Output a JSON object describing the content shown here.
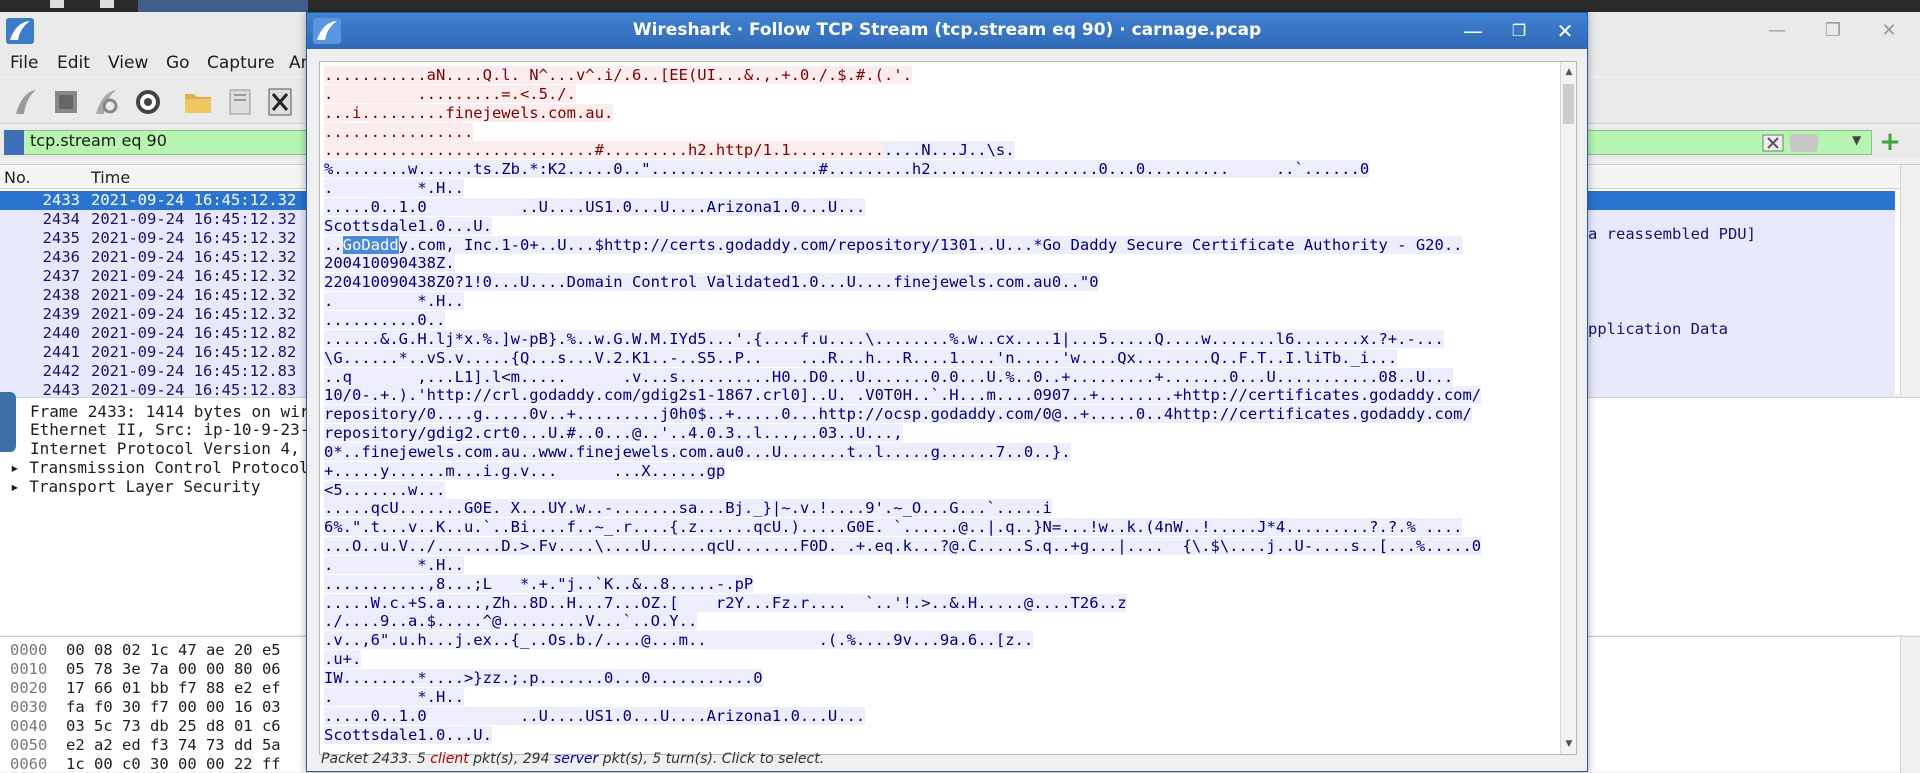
{
  "main_window": {
    "menu": [
      "File",
      "Edit",
      "View",
      "Go",
      "Capture",
      "An"
    ],
    "filter_value": "tcp.stream eq 90",
    "packet_list": {
      "columns": [
        "No.",
        "Time"
      ],
      "rows": [
        {
          "no": "2433",
          "time": "2021-09-24 16:45:12.32",
          "selected": true
        },
        {
          "no": "2434",
          "time": "2021-09-24 16:45:12.32"
        },
        {
          "no": "2435",
          "time": "2021-09-24 16:45:12.32"
        },
        {
          "no": "2436",
          "time": "2021-09-24 16:45:12.32"
        },
        {
          "no": "2437",
          "time": "2021-09-24 16:45:12.32"
        },
        {
          "no": "2438",
          "time": "2021-09-24 16:45:12.32"
        },
        {
          "no": "2439",
          "time": "2021-09-24 16:45:12.32"
        },
        {
          "no": "2440",
          "time": "2021-09-24 16:45:12.82"
        },
        {
          "no": "2441",
          "time": "2021-09-24 16:45:12.82"
        },
        {
          "no": "2442",
          "time": "2021-09-24 16:45:12.83"
        },
        {
          "no": "2443",
          "time": "2021-09-24 16:45:12.83"
        }
      ],
      "right_info_1": "a reassembled PDU]",
      "right_info_2": "pplication Data"
    },
    "details": [
      "Frame 2433: 1414 bytes on wir",
      "Ethernet II, Src: ip-10-9-23-",
      "Internet Protocol Version 4,",
      "Transmission Control Protocol",
      "Transport Layer Security"
    ],
    "hex": [
      {
        "off": "0000",
        "bytes": "00 08 02 1c 47 ae 20 e5"
      },
      {
        "off": "0010",
        "bytes": "05 78 3e 7a 00 00 80 06"
      },
      {
        "off": "0020",
        "bytes": "17 66 01 bb f7 88 e2 ef"
      },
      {
        "off": "0030",
        "bytes": "fa f0 30 f7 00 00 16 03"
      },
      {
        "off": "0040",
        "bytes": "03 5c 73 db 25 d8 01 c6"
      },
      {
        "off": "0050",
        "bytes": "e2 a2 ed f3 74 73 dd 5a"
      },
      {
        "off": "0060",
        "bytes": "1c 00 c0 30 00 00 22 ff"
      }
    ]
  },
  "dialog": {
    "title": "Wireshark · Follow TCP Stream (tcp.stream eq 90) · carnage.pcap",
    "status_prefix": "Packet 2433. 5 ",
    "status_client": "client",
    "status_mid": " pkt(s), 294 ",
    "status_server": "server",
    "status_suffix": " pkt(s), 5 turn(s). Click to select.",
    "stream_lines": [
      [
        {
          "t": "...........aN....Q.l. N^...v^.i/.6..[EE(UI...&.,.+.0./.$.#.(.'.",
          "c": "cl"
        }
      ],
      [
        {
          "t": ".         .........=.<.5./.",
          "c": "cl"
        }
      ],
      [
        {
          "t": "...i.........finejewels.com.au.",
          "c": "cl"
        }
      ],
      [
        {
          "t": "................",
          "c": "cl"
        }
      ],
      [
        {
          "t": ".............................#.........h2.http/1.1..........",
          "c": "cl"
        },
        {
          "t": "....N...J..\\s.",
          "c": "sv"
        }
      ],
      [
        {
          "t": "%........w......ts.Zb.*:K2.....0..\"..................#.........h2..................0...0.........     ..`......0",
          "c": "sv"
        }
      ],
      [
        {
          "t": ".         *.H..",
          "c": "sv"
        }
      ],
      [
        {
          "t": ".....0..1.0          ..U....US1.0...U....Arizona1.0...U...",
          "c": "sv"
        }
      ],
      [
        {
          "t": "Scottsdale1.0...U.",
          "c": "sv"
        }
      ],
      [
        {
          "t": "..",
          "c": "sv"
        },
        {
          "t": "GoDadd",
          "c": "hl"
        },
        {
          "t": "y.com, Inc.1-0+..U...$http://certs.godaddy.com/repository/1301..U...*Go Daddy Secure Certificate Authority - G20..",
          "c": "sv"
        }
      ],
      [
        {
          "t": "200410090438Z.",
          "c": "sv"
        }
      ],
      [
        {
          "t": "220410090438Z0?1!0...U....Domain Control Validated1.0...U....finejewels.com.au0..\"0",
          "c": "sv"
        }
      ],
      [
        {
          "t": ".         *.H..",
          "c": "sv"
        }
      ],
      [
        {
          "t": "..........0..",
          "c": "sv"
        }
      ],
      [
        {
          "t": "......&.G.H.lj*x.%.]w-pB}.%..w.G.W.M.IYd5...'.{....f.u....\\........%.w..cx....1|...5.....Q....w.......l6.......x.?+.-...",
          "c": "sv"
        }
      ],
      [
        {
          "t": "\\G......*..vS.v.....{Q...s...V.2.K1..-..S5..P..    ...R...h...R....1....'n.....'w....Qx........Q..F.T..I.liTb._i...",
          "c": "sv"
        }
      ],
      [
        {
          "t": "..q       ,...L1].l<m.....      .v...s..........H0..D0...U.......0.0...U.%..0..+.........+.......0...U...........08..U...",
          "c": "sv"
        }
      ],
      [
        {
          "t": "10/0-.+.).'http://crl.godaddy.com/gdig2s1-1867.crl0]..U. .V0T0H..`.H...m....0907..+........+http://certificates.godaddy.com/",
          "c": "sv"
        }
      ],
      [
        {
          "t": "repository/0....g.....0v..+.........j0h0$..+.....0...http://ocsp.godaddy.com/0@..+.....0..4http://certificates.godaddy.com/",
          "c": "sv"
        }
      ],
      [
        {
          "t": "repository/gdig2.crt0...U.#..0...@..'..4.0.3..l...,..03..U...,",
          "c": "sv"
        }
      ],
      [
        {
          "t": "0*..finejewels.com.au..www.finejewels.com.au0...U.......t..l.....g......7..0..}.",
          "c": "sv"
        }
      ],
      [
        {
          "t": "+.....y......m...i.g.v...      ...X......gp",
          "c": "sv"
        }
      ],
      [
        {
          "t": "<5.......w...",
          "c": "sv"
        }
      ],
      [
        {
          "t": ".....qcU.......G0E. X...UY.w..-.......sa...Bj._}|~.v.!....9'.~_O...G...`.....i",
          "c": "sv"
        }
      ],
      [
        {
          "t": "6%.\".t...v..K..u.`..Bi....f..~_.r....{.z......qcU.).....G0E. `......@..|.q..}N=...!w..k.(4nW..!.....J*4.........?.?.% ....",
          "c": "sv"
        }
      ],
      [
        {
          "t": "...O..u.V../.......D.>.Fv....\\....U......qcU.......F0D. .+.eq.k...?@.C.....S.q..+g...|....  {\\.$\\....j..U-....s..[...%.....0",
          "c": "sv"
        }
      ],
      [
        {
          "t": ".         *.H..",
          "c": "sv"
        }
      ],
      [
        {
          "t": "...........,8...;L   *.+.\"j..`K..&..8.....-.pP",
          "c": "sv"
        }
      ],
      [
        {
          "t": ".....W.c.+S.a....,Zh..8D..H...7...OZ.[    r2Y...Fz.r....  `..'!.>..&.H.....@....T26..z",
          "c": "sv"
        }
      ],
      [
        {
          "t": "./....9..a.$.....^@.........V...`..O.Y..",
          "c": "sv"
        }
      ],
      [
        {
          "t": ".v..,6\".u.h...j.ex..{_..Os.b./....@...m..            .(.%....9v...9a.6..[z..",
          "c": "sv"
        }
      ],
      [
        {
          "t": ".u+.",
          "c": "sv"
        }
      ],
      [
        {
          "t": "IW........*....>}zz.;.p.......0...0...........0",
          "c": "sv"
        }
      ],
      [
        {
          "t": ".         *.H..",
          "c": "sv"
        }
      ],
      [
        {
          "t": ".....0..1.0          ..U....US1.0...U....Arizona1.0...U...",
          "c": "sv"
        }
      ],
      [
        {
          "t": "Scottsdale1.0...U.",
          "c": "sv"
        }
      ]
    ]
  }
}
